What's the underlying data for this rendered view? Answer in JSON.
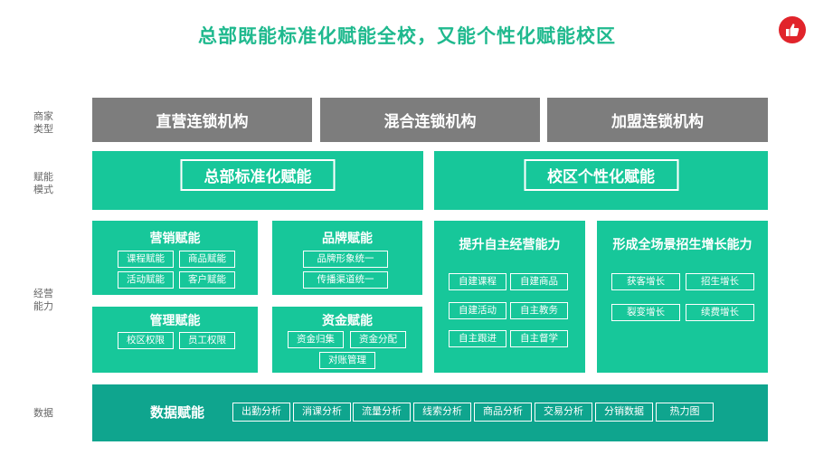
{
  "title": "总部既能标准化赋能全校，又能个性化赋能校区",
  "side_labels": {
    "merchant_type": "商家\n类型",
    "empower_mode": "赋能\n模式",
    "operation": "经营\n能力",
    "data": "数据"
  },
  "merchant_types": [
    "直营连锁机构",
    "混合连锁机构",
    "加盟连锁机构"
  ],
  "modes": {
    "hq": "总部标准化赋能",
    "campus": "校区个性化赋能"
  },
  "hq_sections": {
    "marketing": {
      "title": "营销赋能",
      "tags": [
        "课程赋能",
        "商品赋能",
        "活动赋能",
        "客户赋能"
      ]
    },
    "brand": {
      "title": "品牌赋能",
      "tags": [
        "品牌形象统一",
        "传播渠道统一"
      ]
    },
    "management": {
      "title": "管理赋能",
      "tags": [
        "校区权限",
        "员工权限"
      ]
    },
    "funds": {
      "title": "资金赋能",
      "tags": [
        "资金归集",
        "资金分配",
        "对账管理"
      ]
    }
  },
  "campus_sections": {
    "self_op": {
      "title": "提升自主经营能力",
      "tags": [
        "自建课程",
        "自建商品",
        "自建活动",
        "自主教务",
        "自主跟进",
        "自主督学"
      ]
    },
    "growth": {
      "title": "形成全场景招生增长能力",
      "tags": [
        "获客增长",
        "招生增长",
        "裂变增长",
        "续费增长"
      ]
    }
  },
  "data_section": {
    "title": "数据赋能",
    "tags": [
      "出勤分析",
      "消课分析",
      "流量分析",
      "线索分析",
      "商品分析",
      "交易分析",
      "分销数据",
      "热力图"
    ]
  },
  "colors": {
    "accent": "#1fb98e",
    "green": "#17c79a",
    "teal": "#0fa58e",
    "gray": "#7d7d7d",
    "logo": "#e1242b"
  },
  "icons": {
    "logo": "thumbs-up-icon"
  }
}
